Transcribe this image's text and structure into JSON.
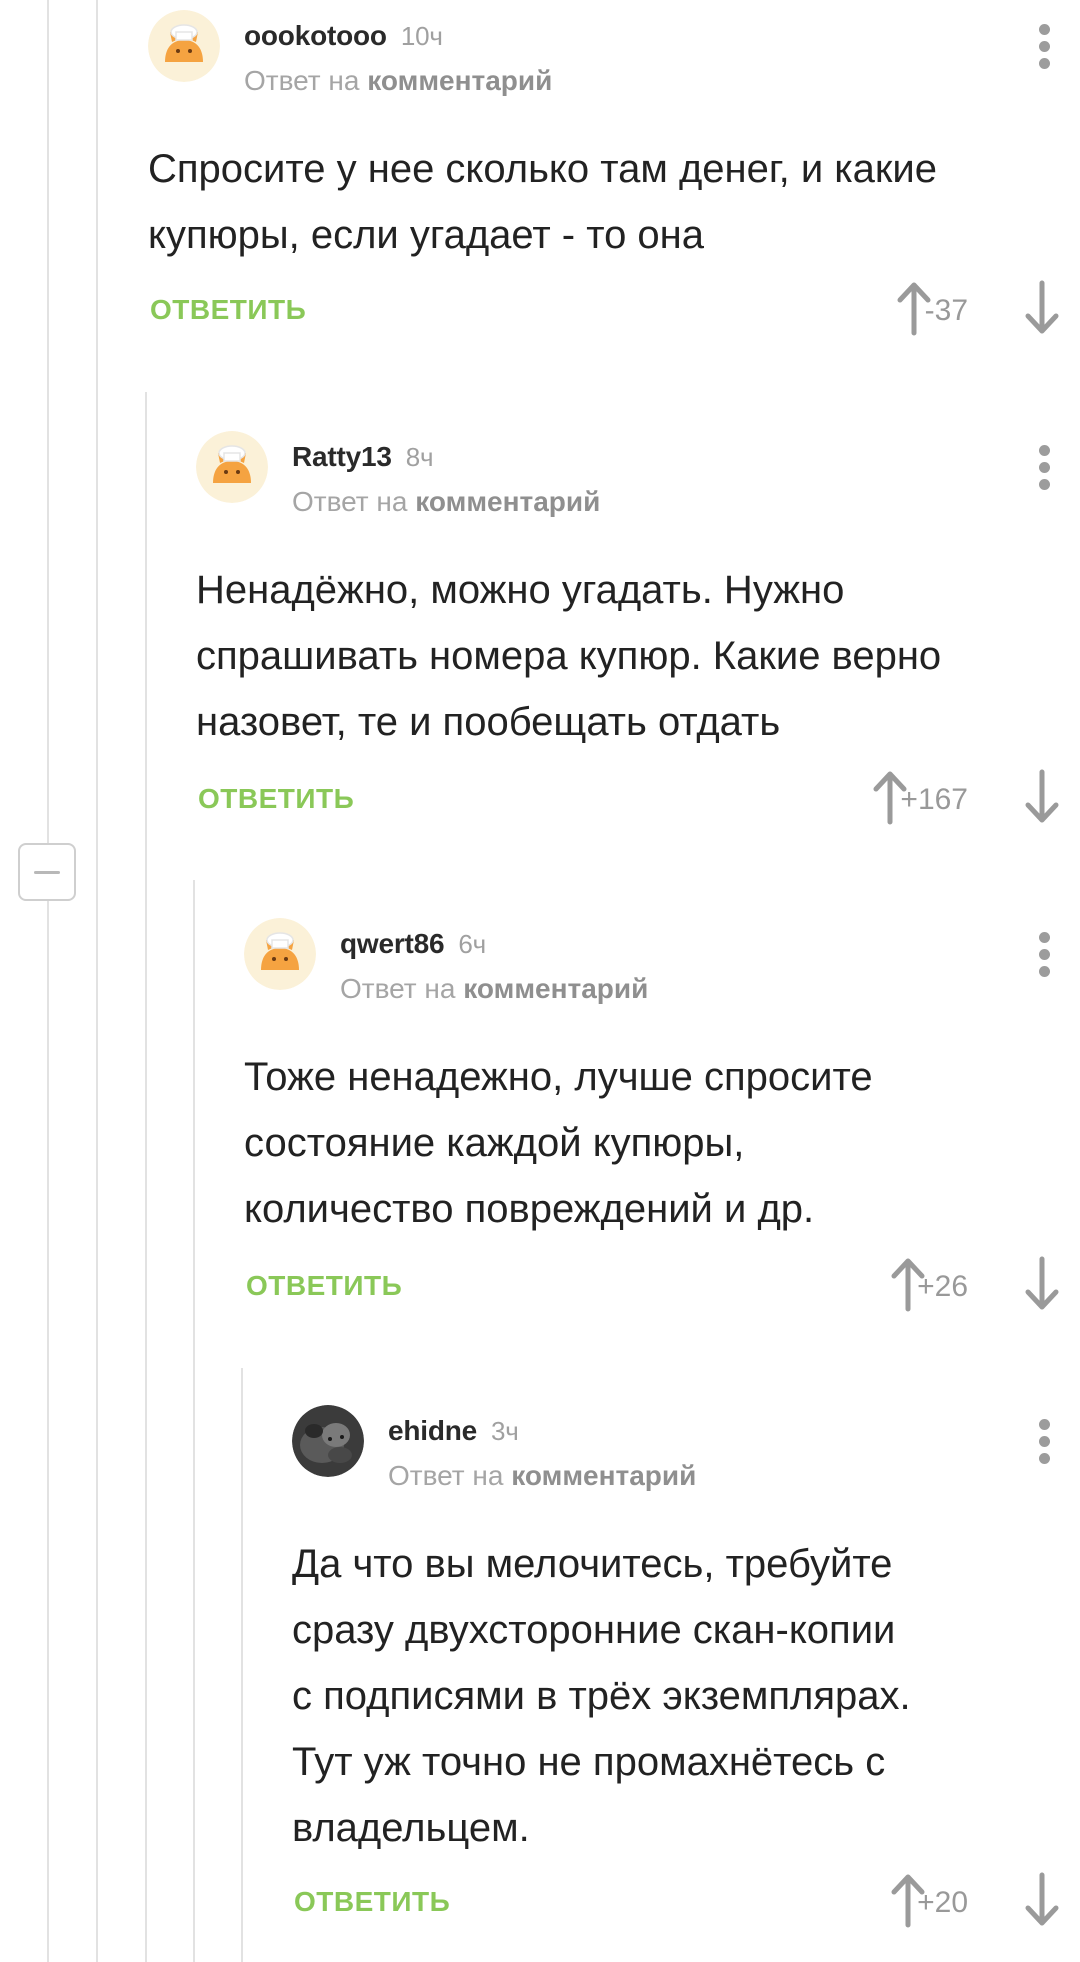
{
  "comments": [
    {
      "username": "oookotooo",
      "time": "10ч",
      "reply_prefix": "Ответ на",
      "reply_link": "комментарий",
      "lines": [
        "Спросите у нее сколько там денег, и какие",
        "купюры, если угадает - то она"
      ],
      "reply_label": "ОТВЕТИТЬ",
      "rating": "-37",
      "avatar": "cat-avatar-default"
    },
    {
      "username": "Ratty13",
      "time": "8ч",
      "reply_prefix": "Ответ на",
      "reply_link": "комментарий",
      "lines": [
        "Ненадёжно, можно угадать. Нужно",
        "спрашивать номера купюр. Какие верно",
        "назовет, те и пообещать отдать"
      ],
      "reply_label": "ОТВЕТИТЬ",
      "rating": "+167",
      "avatar": "cat-avatar-default"
    },
    {
      "username": "qwert86",
      "time": "6ч",
      "reply_prefix": "Ответ на",
      "reply_link": "комментарий",
      "lines": [
        "Тоже ненадежно, лучше спросите",
        "состояние каждой купюры,",
        "количество повреждений и др."
      ],
      "reply_label": "ОТВЕТИТЬ",
      "rating": "+26",
      "avatar": "cat-avatar-default"
    },
    {
      "username": "ehidne",
      "time": "3ч",
      "reply_prefix": "Ответ на",
      "reply_link": "комментарий",
      "lines": [
        "Да что вы мелочитесь, требуйте",
        "сразу двухсторонние скан-копии",
        "с подписями в трёх экземплярах.",
        "Тут уж точно не промахнётесь с",
        "владельцем."
      ],
      "reply_label": "ОТВЕТИТЬ",
      "rating": "+20",
      "avatar": "photo-avatar"
    }
  ],
  "icons": {
    "more": "more-vertical-icon",
    "upvote": "arrow-up-icon",
    "downvote": "arrow-down-icon",
    "collapse": "minus-icon"
  },
  "colors": {
    "accent_green": "#8ac858",
    "muted_text": "#a5a5a5",
    "rating_text": "#999999",
    "thread_line": "#e2e2e2"
  }
}
